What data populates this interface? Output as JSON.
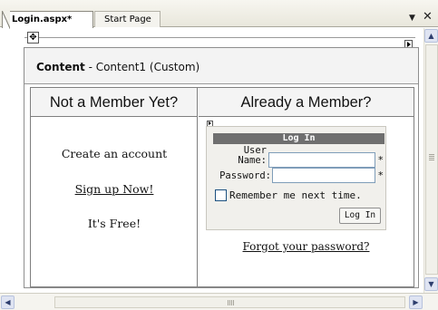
{
  "tabs": [
    {
      "label": "Login.aspx*",
      "active": true
    },
    {
      "label": "Start Page",
      "active": false
    }
  ],
  "tabstrip_controls": {
    "dropdown_icon": "chevron-down-icon",
    "close_icon": "close-icon"
  },
  "content": {
    "title_bold": "Content",
    "title_rest": " - Content1 (Custom)"
  },
  "left_column": {
    "header": "Not a Member Yet?",
    "line1": "Create an account",
    "link": "Sign up Now!",
    "line3": "It's Free!"
  },
  "right_column": {
    "header": "Already a Member?",
    "login": {
      "title": "Log In",
      "username_label_line1": "User",
      "username_label_line2": "Name:",
      "username_value": "",
      "password_label": "Password:",
      "password_value": "",
      "required_mark": "*",
      "remember_label": "Remember me next time.",
      "remember_checked": false,
      "button_label": "Log In"
    },
    "forgot_link": "Forgot your password?"
  }
}
